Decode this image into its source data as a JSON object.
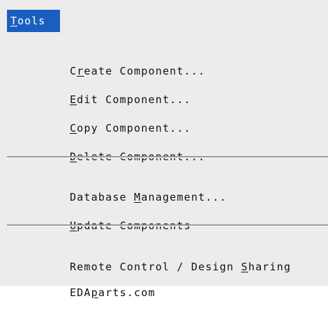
{
  "menu": {
    "title_mnemonic": "T",
    "title_rest": "ools",
    "items": [
      {
        "pre": "C",
        "mn": "r",
        "post": "eate Component..."
      },
      {
        "pre": "",
        "mn": "E",
        "post": "dit Component..."
      },
      {
        "pre": "",
        "mn": "C",
        "post": "opy Component..."
      },
      {
        "pre": "",
        "mn": "D",
        "post": "elete Component..."
      },
      {
        "pre": "Database ",
        "mn": "M",
        "post": "anagement..."
      },
      {
        "pre": "",
        "mn": "U",
        "post": "pdate Components"
      },
      {
        "pre": "Remote Control / Design ",
        "mn": "S",
        "post": "haring"
      },
      {
        "pre": "EDA",
        "mn": "p",
        "post": "arts.com"
      }
    ]
  },
  "colors": {
    "menu_background": "#ececec",
    "highlight": "#1a5fbf",
    "text": "#111111",
    "separator": "#9a9a9a"
  }
}
